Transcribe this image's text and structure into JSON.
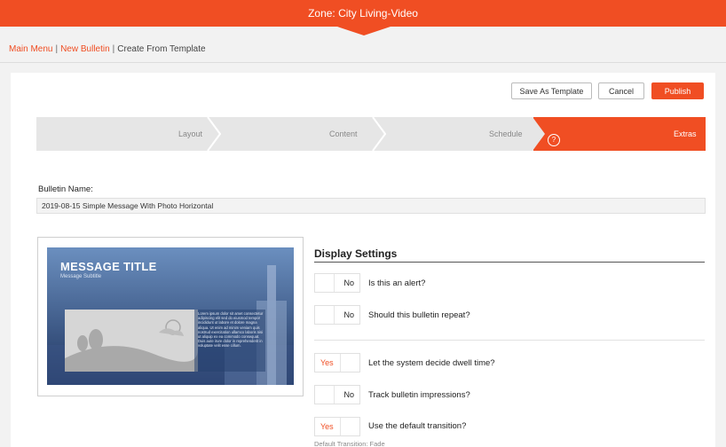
{
  "header": {
    "title": "Zone: City Living-Video"
  },
  "breadcrumb": {
    "main_menu": "Main Menu",
    "new_bulletin": "New Bulletin",
    "current": "Create From Template",
    "separator": "|"
  },
  "toolbar": {
    "save_template": "Save As Template",
    "cancel": "Cancel",
    "publish": "Publish"
  },
  "stepper": {
    "steps": [
      "Layout",
      "Content",
      "Schedule",
      "Extras"
    ],
    "active": "Extras",
    "help_glyph": "?"
  },
  "bulletin": {
    "name_label": "Bulletin Name:",
    "name_value": "2019-08-15 Simple Message With Photo Horizontal"
  },
  "preview": {
    "title": "MESSAGE TITLE",
    "subtitle": "Message Subtitle",
    "body": "Lorem ipsum dolor sit amet consectetur adipiscing elit sed do eiusmod tempor incididunt ut labore et dolore magna aliqua. Ut enim ad minim veniam quis nostrud exercitation ullamco laboris nisi ut aliquip ex ea commodo consequat. Duis aute irure dolor in reprehenderit in voluptate velit esse cillum."
  },
  "display_settings": {
    "title": "Display Settings",
    "items": [
      {
        "toggle": "No",
        "state": false,
        "question": "Is this an alert?"
      },
      {
        "toggle": "No",
        "state": false,
        "question": "Should this bulletin repeat?"
      },
      {
        "toggle": "Yes",
        "state": true,
        "question": "Let the system decide dwell time?"
      },
      {
        "toggle": "No",
        "state": false,
        "question": "Track bulletin impressions?"
      },
      {
        "toggle": "Yes",
        "state": true,
        "question": "Use the default transition?"
      }
    ],
    "transition_note": "Default Transition: Fade"
  },
  "colors": {
    "accent": "#f04e23",
    "background": "#f2f2f2",
    "stepper_bg": "#e6e6e6"
  }
}
